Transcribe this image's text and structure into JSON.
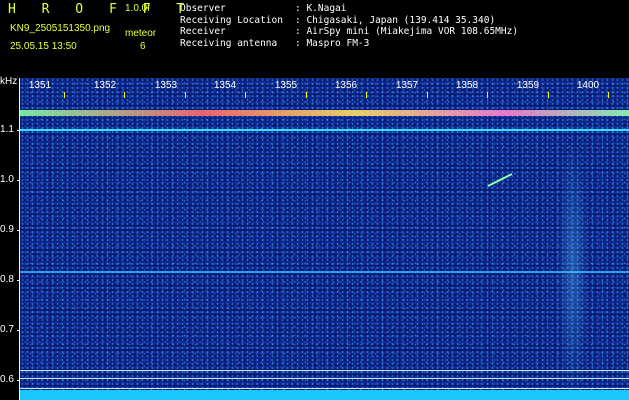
{
  "header": {
    "logo": "H R O F F T",
    "version": "1.0.0f",
    "filename": "KN9_2505151350.png",
    "meteor_label": "meteor",
    "datetime": "25.05.15 13:50",
    "meteor_count": "6"
  },
  "info": [
    {
      "key": "Observer",
      "value": ": K.Nagai"
    },
    {
      "key": "Receiving Location",
      "value": ": Chigasaki, Japan (139.414 35.340)"
    },
    {
      "key": "Receiver",
      "value": ": AirSpy mini (Miakejima VOR 108.65MHz)"
    },
    {
      "key": "Receiving antenna",
      "value": ": Maspro FM-3"
    }
  ],
  "axis": {
    "x_ticks": [
      "1351",
      "1352",
      "1353",
      "1354",
      "1355",
      "1356",
      "1357",
      "1358",
      "1359",
      "1400"
    ],
    "y_unit": "kHz",
    "y_ticks": [
      "1.1",
      "1.0",
      "0.9",
      "0.8",
      "0.7",
      "0.6"
    ]
  },
  "colors": {
    "header_text": "#e8ff3a",
    "background": "#0a1a72",
    "band": "#19c7ff"
  }
}
